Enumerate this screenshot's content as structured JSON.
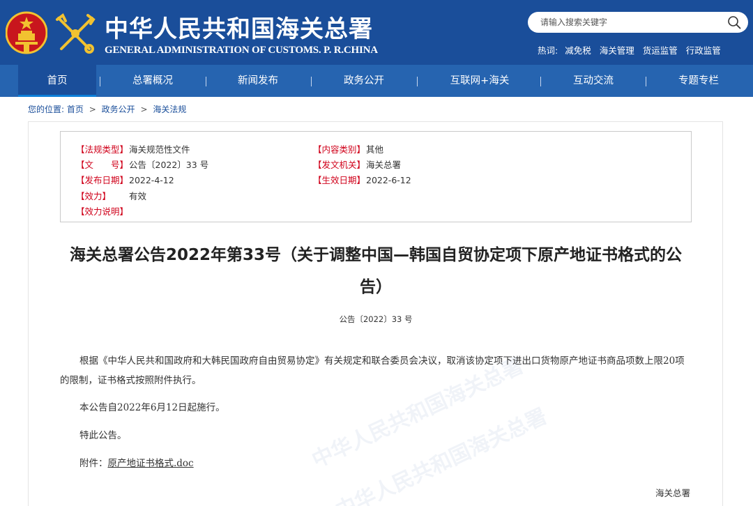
{
  "header": {
    "title": "中华人民共和国海关总署",
    "subtitle": "GENERAL ADMINISTRATION OF CUSTOMS. P. R.CHINA",
    "emblem_icon": "national-emblem-icon",
    "logo_icon": "customs-emblem-icon",
    "bg_color": "#1a4e9a"
  },
  "search": {
    "placeholder": "请输入搜索关键字",
    "icon": "search-icon"
  },
  "hotwords": {
    "label": "热词:",
    "items": [
      "减免税",
      "海关管理",
      "货运监管",
      "行政监管"
    ]
  },
  "nav": {
    "items": [
      "首页",
      "总署概况",
      "新闻发布",
      "政务公开",
      "互联网+海关",
      "互动交流",
      "专题专栏"
    ],
    "separator": "|",
    "active": "首页"
  },
  "breadcrumb": {
    "label": "您的位置:",
    "items": [
      "首页",
      "政务公开",
      "海关法规"
    ],
    "separator": ">"
  },
  "meta": {
    "type_key": "【法规类型】",
    "type_val": "海关规范性文件",
    "category_key": "【内容类别】",
    "category_val": "其他",
    "docno_key": "【文　　号】",
    "docno_val": "公告〔2022〕33 号",
    "issuer_key": "【发文机关】",
    "issuer_val": "海关总署",
    "pubdate_key": "【发布日期】",
    "pubdate_val": "2022-4-12",
    "effdate_key": "【生效日期】",
    "effdate_val": "2022-6-12",
    "validity_key": "【效力】",
    "validity_val": "有效",
    "note_key": "【效力说明】",
    "note_val": ""
  },
  "document": {
    "title": "海关总署公告2022年第33号（关于调整中国—韩国自贸协定项下原产地证书格式的公告）",
    "number": "公告〔2022〕33 号",
    "para1": "根据《中华人民共和国政府和大韩民国政府自由贸易协定》有关规定和联合委员会决议，取消该协定项下进出口货物原产地证书商品项数上限20项的限制，证书格式按照附件执行。",
    "para2": "本公告自2022年6月12日起施行。",
    "para3": "特此公告。",
    "attach_label": "附件：",
    "attach_link": "原产地证书格式.doc",
    "signature": "海关总署"
  },
  "colors": {
    "header": "#1a4e9a",
    "nav": "#2664b0",
    "meta_key": "#d0021b"
  }
}
